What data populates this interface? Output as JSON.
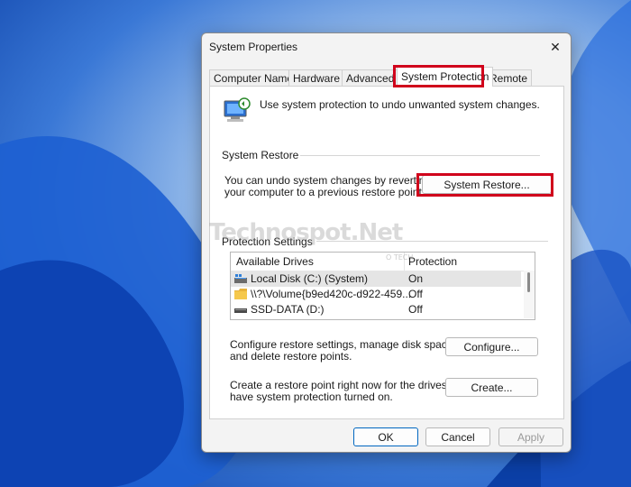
{
  "window": {
    "title": "System Properties",
    "close": "✕"
  },
  "tabs": [
    {
      "label": "Computer Name"
    },
    {
      "label": "Hardware"
    },
    {
      "label": "Advanced"
    },
    {
      "label": "System Protection"
    },
    {
      "label": "Remote"
    }
  ],
  "intro_text": "Use system protection to undo unwanted system changes.",
  "system_restore": {
    "heading": "System Restore",
    "description_line1": "You can undo system changes by reverting",
    "description_line2": "your computer to a previous restore point.",
    "button": "System Restore..."
  },
  "protection": {
    "heading": "Protection Settings",
    "columns": [
      "Available Drives",
      "Protection"
    ],
    "drives": [
      {
        "name": "Local Disk (C:) (System)",
        "protection": "On",
        "icon": "system-drive-icon"
      },
      {
        "name": "\\\\?\\Volume{b9ed420c-d922-459...",
        "protection": "Off",
        "icon": "folder-icon"
      },
      {
        "name": "SSD-DATA (D:)",
        "protection": "Off",
        "icon": "drive-icon"
      }
    ],
    "configure_text_line1": "Configure restore settings, manage disk space,",
    "configure_text_line2": "and delete restore points.",
    "configure_button": "Configure...",
    "create_text_line1": "Create a restore point right now for the drives that",
    "create_text_line2": "have system protection turned on.",
    "create_button": "Create..."
  },
  "footer": {
    "ok": "OK",
    "cancel": "Cancel",
    "apply": "Apply"
  },
  "watermark": {
    "text": "Technospot.Net",
    "sub": "O TECH"
  },
  "colors": {
    "highlight": "#d0021b",
    "accent": "#0067c0"
  }
}
